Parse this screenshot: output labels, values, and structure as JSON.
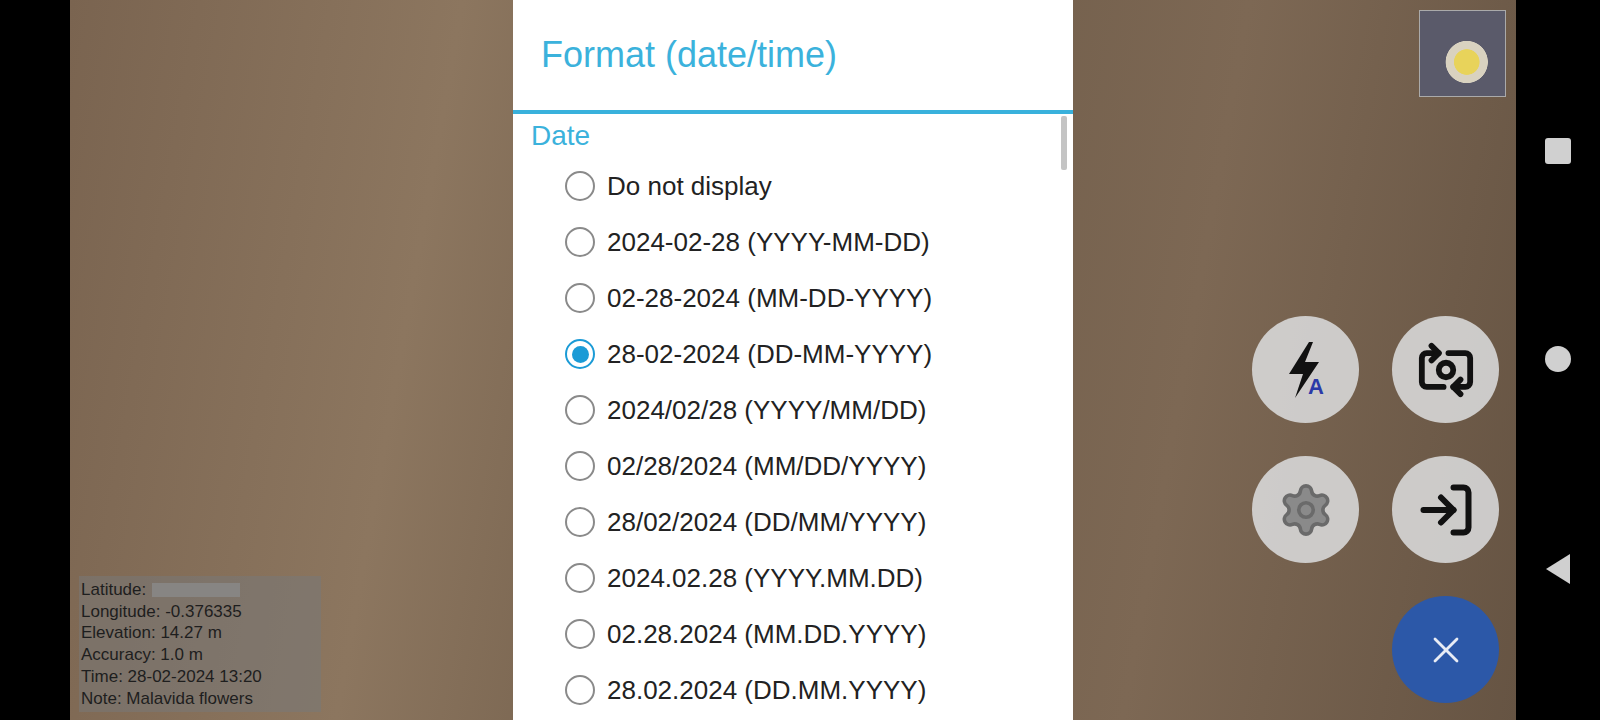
{
  "dialog": {
    "title": "Format (date/time)",
    "section": "Date",
    "options": [
      {
        "label": "Do not display",
        "selected": false
      },
      {
        "label": "2024-02-28 (YYYY-MM-DD)",
        "selected": false
      },
      {
        "label": "02-28-2024 (MM-DD-YYYY)",
        "selected": false
      },
      {
        "label": "28-02-2024 (DD-MM-YYYY)",
        "selected": true
      },
      {
        "label": "2024/02/28 (YYYY/MM/DD)",
        "selected": false
      },
      {
        "label": "02/28/2024 (MM/DD/YYYY)",
        "selected": false
      },
      {
        "label": "28/02/2024 (DD/MM/YYYY)",
        "selected": false
      },
      {
        "label": "2024.02.28 (YYYY.MM.DD)",
        "selected": false
      },
      {
        "label": "02.28.2024 (MM.DD.YYYY)",
        "selected": false
      },
      {
        "label": "28.02.2024 (DD.MM.YYYY)",
        "selected": false
      }
    ]
  },
  "overlay": {
    "lines": [
      {
        "text": "Latitude:",
        "redacted": true
      },
      {
        "text": "Longitude: -0.376335",
        "redacted": false
      },
      {
        "text": "Elevation: 14.27 m",
        "redacted": false
      },
      {
        "text": "Accuracy: 1.0 m",
        "redacted": false
      },
      {
        "text": "Time: 28-02-2024 13:20",
        "redacted": false
      },
      {
        "text": "Note: Malavida flowers",
        "redacted": false
      }
    ]
  },
  "flash": {
    "badge": "A"
  }
}
